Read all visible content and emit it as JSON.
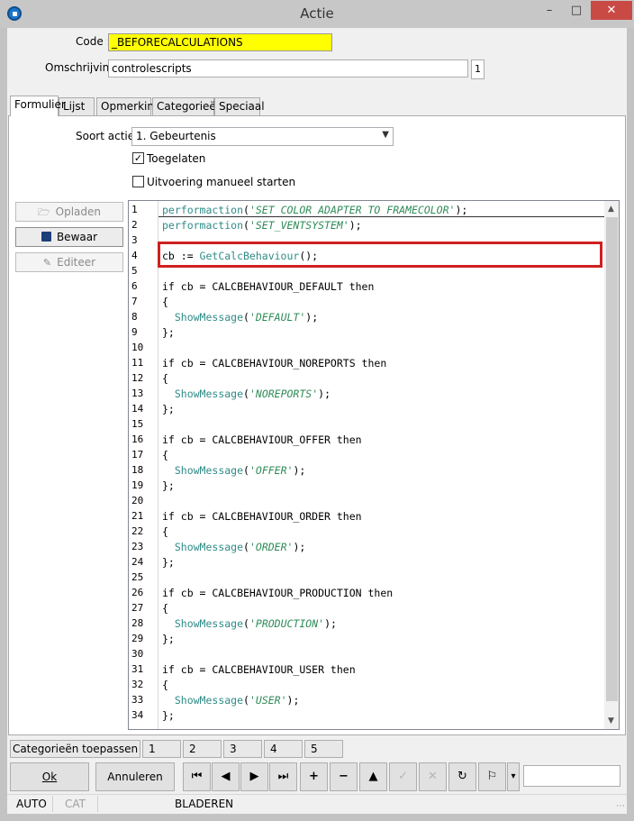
{
  "window": {
    "title": "Actie",
    "minimize_glyph": "–",
    "maximize_glyph": "□",
    "close_glyph": "✕"
  },
  "form": {
    "code_label": "Code :",
    "code_value": "_BEFORECALCULATIONS",
    "desc_label": "Omschrijving :",
    "desc_value": "controlescripts",
    "desc_counter": "1"
  },
  "tabs": [
    {
      "label": "Formulier",
      "active": true
    },
    {
      "label": "Lijst"
    },
    {
      "label": "Opmerking"
    },
    {
      "label": "Categorieën"
    },
    {
      "label": "Speciaal"
    }
  ],
  "formulier": {
    "soort_label": "Soort actie :",
    "soort_value": "1.  Gebeurtenis",
    "toegelaten_label": "Toegelaten",
    "toegelaten_checked": true,
    "manueel_label": "Uitvoering manueel starten",
    "manueel_checked": false
  },
  "side_buttons": {
    "opladen": "Opladen",
    "bewaar": "Bewaar",
    "editeer": "Editeer"
  },
  "editor": {
    "lines": [
      {
        "n": "1",
        "t": "performaction('SET COLOR ADAPTER TO FRAMECOLOR');"
      },
      {
        "n": "2",
        "t": "performaction('SET_VENTSYSTEM');"
      },
      {
        "n": "3",
        "t": ""
      },
      {
        "n": "4",
        "t": "cb := GetCalcBehaviour();"
      },
      {
        "n": "5",
        "t": ""
      },
      {
        "n": "6",
        "t": "if cb = CALCBEHAVIOUR_DEFAULT then"
      },
      {
        "n": "7",
        "t": "{"
      },
      {
        "n": "8",
        "t": "  ShowMessage('DEFAULT');"
      },
      {
        "n": "9",
        "t": "};"
      },
      {
        "n": "10",
        "t": ""
      },
      {
        "n": "11",
        "t": "if cb = CALCBEHAVIOUR_NOREPORTS then"
      },
      {
        "n": "12",
        "t": "{"
      },
      {
        "n": "13",
        "t": "  ShowMessage('NOREPORTS');"
      },
      {
        "n": "14",
        "t": "};"
      },
      {
        "n": "15",
        "t": ""
      },
      {
        "n": "16",
        "t": "if cb = CALCBEHAVIOUR_OFFER then"
      },
      {
        "n": "17",
        "t": "{"
      },
      {
        "n": "18",
        "t": "  ShowMessage('OFFER');"
      },
      {
        "n": "19",
        "t": "};"
      },
      {
        "n": "20",
        "t": ""
      },
      {
        "n": "21",
        "t": "if cb = CALCBEHAVIOUR_ORDER then"
      },
      {
        "n": "22",
        "t": "{"
      },
      {
        "n": "23",
        "t": "  ShowMessage('ORDER');"
      },
      {
        "n": "24",
        "t": "};"
      },
      {
        "n": "25",
        "t": ""
      },
      {
        "n": "26",
        "t": "if cb = CALCBEHAVIOUR_PRODUCTION then"
      },
      {
        "n": "27",
        "t": "{"
      },
      {
        "n": "28",
        "t": "  ShowMessage('PRODUCTION');"
      },
      {
        "n": "29",
        "t": "};"
      },
      {
        "n": "30",
        "t": ""
      },
      {
        "n": "31",
        "t": "if cb = CALCBEHAVIOUR_USER then"
      },
      {
        "n": "32",
        "t": "{"
      },
      {
        "n": "33",
        "t": "  ShowMessage('USER');"
      },
      {
        "n": "34",
        "t": "};"
      }
    ],
    "colors": {
      "function": "#2e8b87",
      "string": "#2e8b57",
      "highlight_box": "#d02020"
    }
  },
  "bottom": {
    "categorieen_toepassen": "Categorieën toepassen",
    "pages": [
      "1",
      "2",
      "3",
      "4",
      "5"
    ],
    "ok": "Ok",
    "annuleren": "Annuleren",
    "nav_icons": {
      "first": "⏮",
      "prev": "◀",
      "next": "▶",
      "last": "⏭",
      "add": "+",
      "remove": "−",
      "up": "▲",
      "confirm": "✓",
      "cancel": "✕",
      "refresh": "↻",
      "find": "⚐",
      "dropdown": "▾"
    }
  },
  "statusbar": {
    "auto": "AUTO",
    "cat": "CAT",
    "bladeren": "BLADEREN"
  }
}
